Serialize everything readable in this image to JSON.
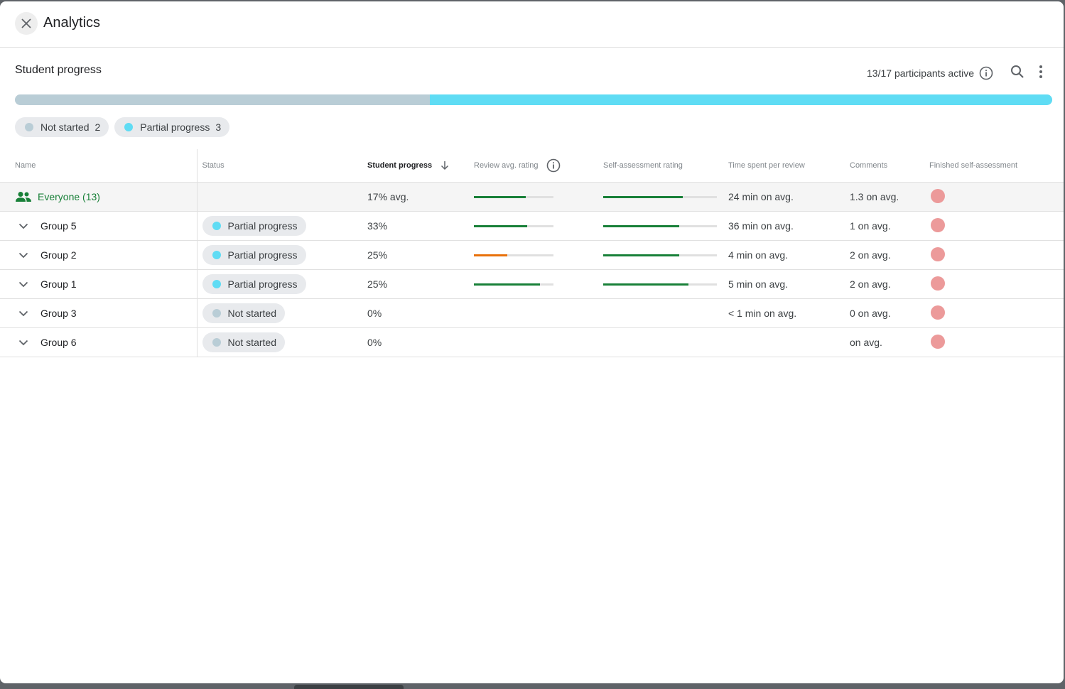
{
  "dialog": {
    "title": "Analytics"
  },
  "section": {
    "title": "Student progress",
    "participants_text": "13/17 participants active"
  },
  "overall_progress": {
    "not_started_fraction": 0.4,
    "partial_fraction": 0.6,
    "colors": {
      "not_started": "#b9cdd6",
      "partial": "#5fdcf4"
    }
  },
  "chips": [
    {
      "label": "Not started",
      "count": "2",
      "color": "#b9cdd6"
    },
    {
      "label": "Partial progress",
      "count": "3",
      "color": "#5fdcf4"
    }
  ],
  "table": {
    "headers": {
      "name": "Name",
      "status": "Status",
      "progress": "Student progress",
      "review": "Review avg. rating",
      "self": "Self-assessment rating",
      "time": "Time spent per review",
      "comments": "Comments",
      "finished": "Finished self-assessment"
    },
    "everyone": {
      "label": "Everyone (13)",
      "progress": "17% avg.",
      "review_fraction": 0.65,
      "review_color": "#188038",
      "self_fraction": 0.7,
      "self_color": "#188038",
      "time": "24 min on avg.",
      "comments": "1.3 on avg."
    },
    "rows": [
      {
        "name": "Group 5",
        "status": "Partial progress",
        "status_color": "#5fdcf4",
        "progress": "33%",
        "review_fraction": 0.67,
        "review_color": "#188038",
        "self_fraction": 0.67,
        "self_color": "#188038",
        "time": "36 min on avg.",
        "comments": "1 on avg."
      },
      {
        "name": "Group 2",
        "status": "Partial progress",
        "status_color": "#5fdcf4",
        "progress": "25%",
        "review_fraction": 0.42,
        "review_color": "#e8710a",
        "self_fraction": 0.67,
        "self_color": "#188038",
        "time": "4 min on avg.",
        "comments": "2 on avg."
      },
      {
        "name": "Group 1",
        "status": "Partial progress",
        "status_color": "#5fdcf4",
        "progress": "25%",
        "review_fraction": 0.83,
        "review_color": "#188038",
        "self_fraction": 0.75,
        "self_color": "#188038",
        "time": "5 min on avg.",
        "comments": "2 on avg."
      },
      {
        "name": "Group 3",
        "status": "Not started",
        "status_color": "#b9cdd6",
        "progress": "0%",
        "review_fraction": null,
        "self_fraction": null,
        "time": "< 1 min on avg.",
        "comments": "0 on avg."
      },
      {
        "name": "Group 6",
        "status": "Not started",
        "status_color": "#b9cdd6",
        "progress": "0%",
        "review_fraction": null,
        "self_fraction": null,
        "time": "",
        "comments": "on avg."
      }
    ]
  },
  "colors": {
    "accent": "#188038",
    "finished_dot": "#ec9a9a"
  }
}
